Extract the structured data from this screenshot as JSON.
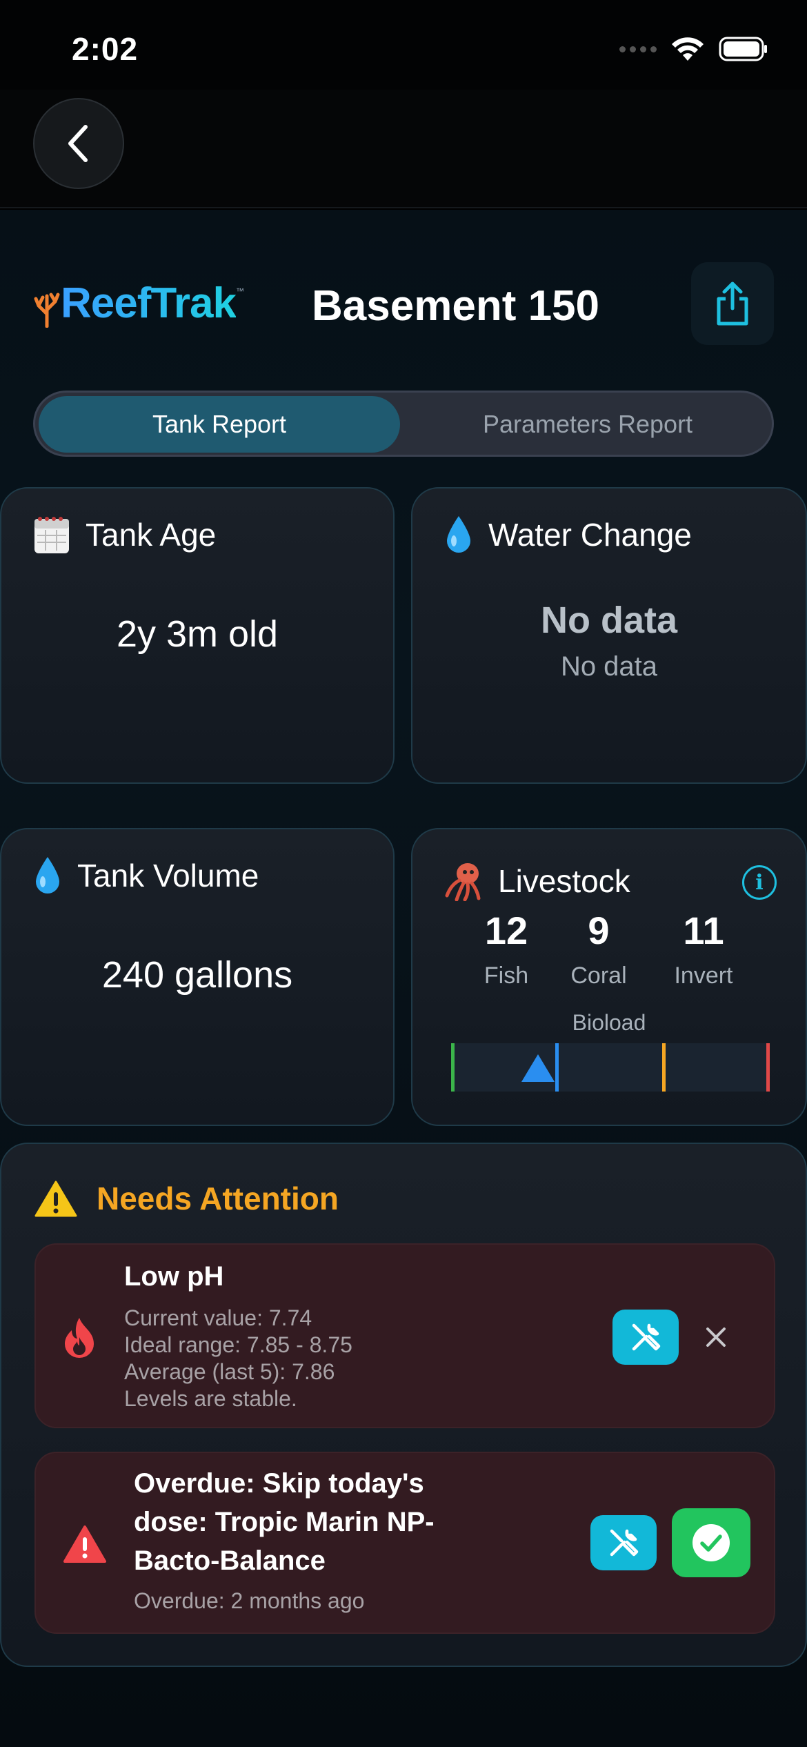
{
  "status_bar": {
    "time": "2:02"
  },
  "header": {
    "logo_text": "ReefTrak",
    "logo_tm": "™",
    "tank_name": "Basement 150"
  },
  "tabs": [
    {
      "label": "Tank Report",
      "active": true
    },
    {
      "label": "Parameters Report",
      "active": false
    }
  ],
  "cards": {
    "tank_age": {
      "title": "Tank Age",
      "value": "2y 3m old"
    },
    "water_change": {
      "title": "Water Change",
      "main": "No data",
      "sub": "No data"
    },
    "tank_volume": {
      "title": "Tank Volume",
      "value": "240 gallons"
    },
    "livestock": {
      "title": "Livestock",
      "stats": [
        {
          "value": "12",
          "label": "Fish"
        },
        {
          "value": "9",
          "label": "Coral"
        },
        {
          "value": "11",
          "label": "Invert"
        }
      ],
      "bioload_label": "Bioload",
      "bioload_colors": [
        "#3bb54a",
        "#2a8ef0",
        "#f5a623",
        "#e04848"
      ]
    }
  },
  "attention": {
    "title": "Needs Attention",
    "alerts": [
      {
        "title": "Low pH",
        "lines": [
          "Current value: 7.74",
          "Ideal range: 7.85 - 8.75",
          "Average (last 5): 7.86",
          "Levels are stable."
        ]
      },
      {
        "title_lines": [
          "Overdue: Skip today's",
          "dose: Tropic Marin NP-",
          "Bacto-Balance"
        ],
        "sub": "Overdue: 2 months ago"
      }
    ]
  },
  "colors": {
    "accent": "#1ec0e0",
    "warning": "#f5a623",
    "alert_bg": "#331b21",
    "success": "#22c55e"
  }
}
